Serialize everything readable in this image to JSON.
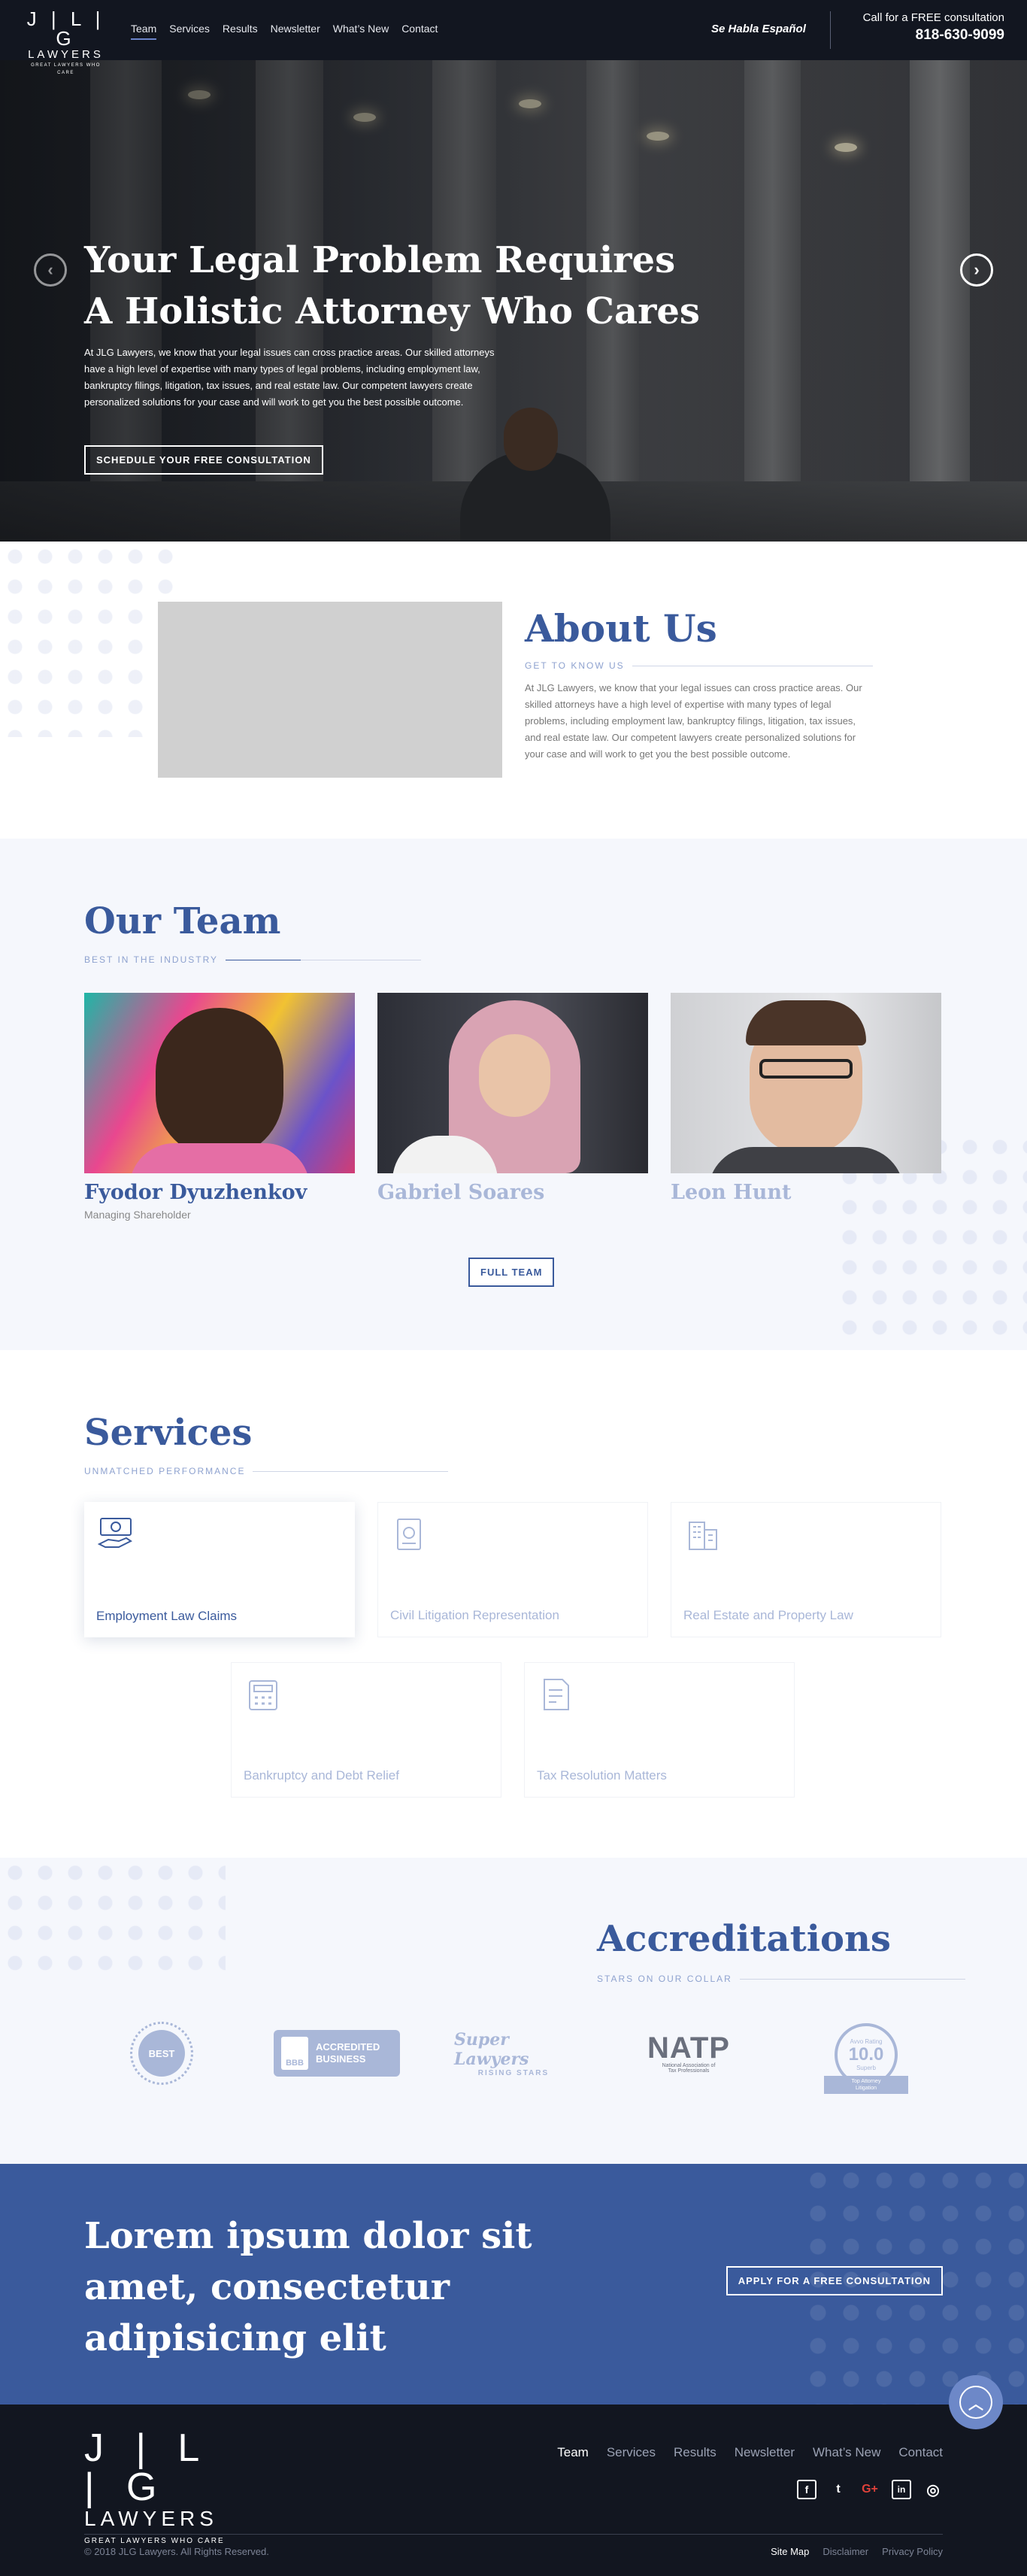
{
  "header": {
    "logo": {
      "letters": "J | L | G",
      "word": "LAWYERS",
      "tagline": "GREAT LAWYERS WHO CARE"
    },
    "nav": [
      {
        "label": "Team",
        "active": true
      },
      {
        "label": "Services",
        "active": false
      },
      {
        "label": "Results",
        "active": false
      },
      {
        "label": "Newsletter",
        "active": false
      },
      {
        "label": "What’s New",
        "active": false
      },
      {
        "label": "Contact",
        "active": false
      }
    ],
    "spanish": "Se Habla Español",
    "call_text": "Call for a FREE consultation",
    "phone": "818-630-9099"
  },
  "hero": {
    "title_line1": "Your Legal Problem Requires",
    "title_line2": "A Holistic Attorney Who Cares",
    "text": "At JLG Lawyers, we know that your legal issues can cross practice areas. Our skilled attorneys have a high level of expertise with many types of legal problems, including employment law, bankruptcy filings, litigation, tax issues, and real estate law. Our competent lawyers create personalized solutions for your case and will work to get you the best possible outcome.",
    "button": "SCHEDULE YOUR FREE CONSULTATION",
    "prev_icon": "‹",
    "next_icon": "›"
  },
  "about": {
    "title": "About Us",
    "subtitle": "GET TO KNOW US",
    "text": "At JLG Lawyers, we know that your legal issues can cross practice areas. Our skilled attorneys have a high level of expertise with many types of legal problems, including employment law, bankruptcy filings, litigation, tax issues, and real estate law. Our competent lawyers create personalized solutions for your case and will work to get you the best possible outcome."
  },
  "team": {
    "title": "Our Team",
    "subtitle": "BEST IN THE INDUSTRY",
    "members": [
      {
        "name": "Fyodor Dyuzhenkov",
        "role": "Managing Shareholder",
        "active": true
      },
      {
        "name": "Gabriel Soares",
        "role": "",
        "active": false
      },
      {
        "name": "Leon Hunt",
        "role": "",
        "active": false
      }
    ],
    "button": "FULL TEAM"
  },
  "services": {
    "title": "Services",
    "subtitle": "UNMATCHED PERFORMANCE",
    "items": [
      {
        "label": "Employment Law Claims",
        "icon": "money-hand-icon",
        "active": true
      },
      {
        "label": "Civil Litigation Representation",
        "icon": "document-icon",
        "active": false
      },
      {
        "label": "Real Estate and Property Law",
        "icon": "building-icon",
        "active": false
      },
      {
        "label": "Bankruptcy and Debt Relief",
        "icon": "calculator-icon",
        "active": false
      },
      {
        "label": "Tax Resolution Matters",
        "icon": "tax-form-icon",
        "active": false
      }
    ]
  },
  "accreditations": {
    "title": "Accreditations",
    "subtitle": "STARS ON OUR COLLAR",
    "logos": [
      {
        "name": "best-of-seal",
        "text": "BEST"
      },
      {
        "name": "bbb",
        "text": "BBB",
        "text2": "ACCREDITED",
        "text3": "BUSINESS"
      },
      {
        "name": "super-lawyers",
        "text": "Super Lawyers",
        "text2": "RISING STARS"
      },
      {
        "name": "natp",
        "text": "NATP",
        "text2": "National Association of",
        "text3": "Tax Professionals"
      },
      {
        "name": "avvo",
        "text": "Avvo Rating",
        "text2": "10.0",
        "text3": "Superb",
        "text4": "Top Attorney",
        "text5": "Litigation"
      }
    ]
  },
  "cta": {
    "title": "Lorem ipsum dolor sit amet, consectetur adipisicing elit",
    "button": "APPLY FOR A FREE CONSULTATION"
  },
  "footer": {
    "logo": {
      "letters": "J | L | G",
      "word": "LAWYERS",
      "tagline": "GREAT LAWYERS WHO CARE"
    },
    "nav": [
      {
        "label": "Team",
        "active": true
      },
      {
        "label": "Services",
        "active": false
      },
      {
        "label": "Results",
        "active": false
      },
      {
        "label": "Newsletter",
        "active": false
      },
      {
        "label": "What’s New",
        "active": false
      },
      {
        "label": "Contact",
        "active": false
      }
    ],
    "social": [
      "facebook-icon",
      "twitter-icon",
      "google-plus-icon",
      "linkedin-icon",
      "instagram-icon"
    ],
    "social_glyphs": [
      "f",
      "t",
      "G+",
      "in",
      "◎"
    ],
    "copyright": "© 2018 JLG Lawyers. All Rights Reserved.",
    "links": [
      {
        "label": "Site Map",
        "active": true
      },
      {
        "label": "Disclaimer",
        "active": false
      },
      {
        "label": "Privacy Policy",
        "active": false
      }
    ]
  },
  "colors": {
    "accent": "#3a5a9c",
    "dark": "#121620",
    "light_bg": "#f5f7fc",
    "muted_link": "#a9b7d8"
  }
}
